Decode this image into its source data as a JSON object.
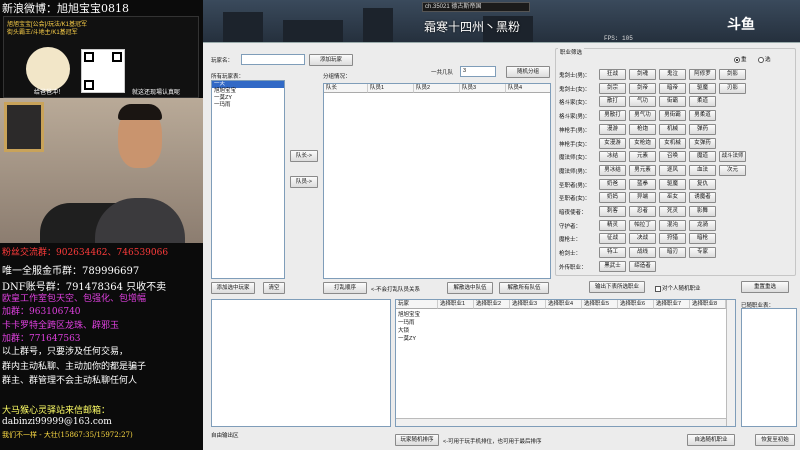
{
  "stream": {
    "title": "新浪微博：旭旭宝宝0818",
    "banner_lines": [
      "旭旭宝宝[公会]/玩法/K1基冠军",
      "街头霸王/斗地主/K1基冠军"
    ],
    "banner_caption": "给爸爸冲！",
    "banner_caption2": "就这还现場认真呢",
    "lines": [
      {
        "text": "粉丝交流群：902634462、746539066",
        "color": "#ff3b3b",
        "size": 9
      },
      {
        "text": "唯一全服金币群：789996697",
        "color": "#ffffff",
        "size": 10
      },
      {
        "text": "DNF账号群：791478364 只收不卖",
        "color": "#ffffff",
        "size": 10
      },
      {
        "text": "欧皇工作室包天空、包强化、包增幅",
        "color": "#e040e0",
        "size": 9
      },
      {
        "text": "加群：963106740",
        "color": "#e040e0",
        "size": 9
      },
      {
        "text": "卡卡罗特全跨区龙珠、辟邪玉",
        "color": "#e040e0",
        "size": 9
      },
      {
        "text": "加群：771647563",
        "color": "#e040e0",
        "size": 9
      },
      {
        "text": "以上群号，只要涉及任何交易，",
        "color": "#ffffff",
        "size": 9
      },
      {
        "text": "群内主动私聊、主动加你的都是骗子",
        "color": "#ffffff",
        "size": 9
      },
      {
        "text": "群主、群管理不会主动私聊任何人",
        "color": "#ffffff",
        "size": 9
      },
      {
        "text": "大马猴心灵驿站来信邮箱：",
        "color": "#ffff66",
        "size": 9
      },
      {
        "text": "dabinzi99999@163.com",
        "color": "#ffffff",
        "size": 9
      },
      {
        "text": "我们不一样 - 大壮(15867:35/15972:27)",
        "color": "#ffdd44",
        "size": 7
      }
    ]
  },
  "game": {
    "channel": "ch.35021 德古斯帝国",
    "server": "霜寒十四州丶黑粉",
    "logo": "斗鱼",
    "fps": "FPS:  105"
  },
  "app": {
    "player_label": "玩家名：",
    "player_value": "",
    "add_player": "添加玩家",
    "all_players_label": "所有玩家表：",
    "all_players": [
      "一天",
      "旭旭宝宝",
      "一莫ZY",
      "一玛雨"
    ],
    "selected_player_index": 0,
    "grouping_label": "分组情况：",
    "team_count_label": "一共几队",
    "team_count_value": "3",
    "random_group": "随机分组",
    "captain_btn": "队长->",
    "member_btn": "队员->",
    "group_cols": [
      "队长",
      "队员1",
      "队员2",
      "队员3",
      "队员4"
    ],
    "shuffle_order": "打乱顺序",
    "not_random_label": "<-不会打乱队员关系",
    "unlock_random": "解散选中队伍",
    "unlock_all": "解散所有队伍",
    "add_to_team": "添加选中玩家",
    "clear": "清空",
    "job_panel_title": "职业筛选",
    "radio_group": [
      "重",
      "选"
    ],
    "radio_selected": 0,
    "job_rows": [
      {
        "label": "鬼剑士(男)：",
        "items": [
          "狂战",
          "剑魂",
          "鬼泣",
          "阿修罗",
          "剑影"
        ]
      },
      {
        "label": "鬼剑士(女)：",
        "items": [
          "剑宗",
          "剑帝",
          "暗帝",
          "驱魔"
        ],
        "extra": "刃影"
      },
      {
        "label": "格斗家(女)：",
        "items": [
          "散打",
          "气功",
          "街霸",
          "柔道"
        ]
      },
      {
        "label": "格斗家(男)：",
        "items": [
          "男散打",
          "男气功",
          "男街霸",
          "男柔道"
        ]
      },
      {
        "label": "神枪手(男)：",
        "items": [
          "漫游",
          "枪炮",
          "机械",
          "弹药"
        ]
      },
      {
        "label": "神枪手(女)：",
        "items": [
          "女漫游",
          "女枪炮",
          "女机械",
          "女弹药"
        ]
      },
      {
        "label": "魔法师(女)：",
        "items": [
          "冰结",
          "元素",
          "召唤",
          "魔道",
          "战斗法师"
        ]
      },
      {
        "label": "魔法师(男)：",
        "items": [
          "男冰结",
          "男元素",
          "逐风",
          "血法",
          "次元"
        ]
      },
      {
        "label": "圣职者(男)：",
        "items": [
          "奶爸",
          "蓝拳",
          "驱魔",
          "复仇"
        ]
      },
      {
        "label": "圣职者(女)：",
        "items": [
          "奶妈",
          "异端",
          "巫女",
          "诱魔者"
        ]
      },
      {
        "label": "暗夜使者：",
        "items": [
          "刺客",
          "忍者",
          "死灵",
          "影舞"
        ]
      },
      {
        "label": "守护者：",
        "items": [
          "精灵",
          "帕拉丁",
          "混沌",
          "龙骑"
        ]
      },
      {
        "label": "魔枪士：",
        "items": [
          "征战",
          "决战",
          "狩猎",
          "暗枪"
        ]
      },
      {
        "label": "枪剑士：",
        "items": [
          "特工",
          "战线",
          "暗刃",
          "专家"
        ]
      },
      {
        "label": "外传职业：",
        "items": [
          "黑武士",
          "缔造者"
        ]
      }
    ],
    "job_left_btn": "输出下表所选职业",
    "job_checkbox": "对个人随机职业",
    "job_right_btn": "重置重选",
    "result_cols": [
      "玩家",
      "选择职业1",
      "选择职业2",
      "选择职业3",
      "选择职业4",
      "选择职业5",
      "选择职业6",
      "选择职业7",
      "选择职业8"
    ],
    "result_rows": [
      "旭旭宝宝",
      "一玛雨",
      "大锁",
      "一莫ZY"
    ],
    "selected_jobs_label": "已随职业表：",
    "log_label": "自由输出区",
    "bottom_random": "玩家随机排序",
    "bottom_hint": "<-可用于玩手机排位，也可用于最后排序",
    "bottom_mid": "自选随机职业",
    "bottom_right": "恢复至初始"
  }
}
